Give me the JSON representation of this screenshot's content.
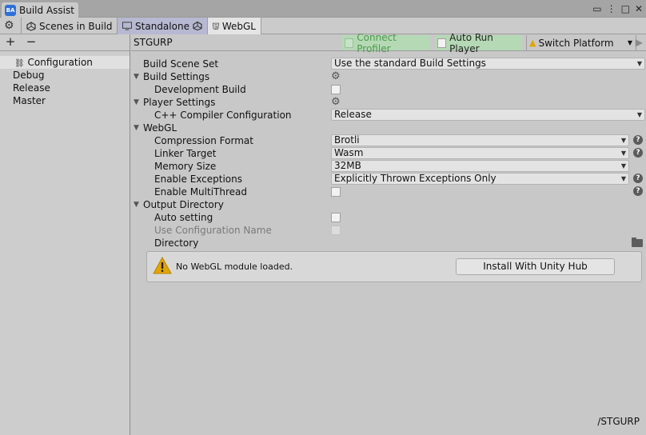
{
  "window": {
    "title": "Build Assist",
    "app_icon_text": "BA"
  },
  "toolbar": {
    "tabs": [
      {
        "label": "Scenes in Build",
        "icon": "unity-logo-icon"
      },
      {
        "label": "Standalone",
        "icon": "monitor-icon"
      },
      {
        "label": "WebGL",
        "icon": "html5-icon"
      }
    ]
  },
  "left_panel": {
    "add_label": "+",
    "remove_label": "−",
    "items": [
      "Configuration",
      "Debug",
      "Release",
      "Master"
    ],
    "selected": "Configuration"
  },
  "right_panel": {
    "title": "STGURP",
    "connect_profiler": "Connect Profiler",
    "auto_run_player": "Auto Run Player",
    "switch_platform": "Switch Platform",
    "rows": {
      "build_scene_set": {
        "label": "Build Scene Set",
        "value": "Use the standard Build Settings"
      },
      "build_settings": "Build Settings",
      "development_build": "Development Build",
      "player_settings": "Player Settings",
      "cpp_compiler": {
        "label": "C++ Compiler Configuration",
        "value": "Release"
      },
      "webgl": "WebGL",
      "compression_format": {
        "label": "Compression Format",
        "value": "Brotli"
      },
      "linker_target": {
        "label": "Linker Target",
        "value": "Wasm"
      },
      "memory_size": {
        "label": "Memory Size",
        "value": "32MB"
      },
      "enable_exceptions": {
        "label": "Enable Exceptions",
        "value": "Explicitly Thrown Exceptions Only"
      },
      "enable_multithread": "Enable MultiThread",
      "output_directory": "Output Directory",
      "auto_setting": "Auto setting",
      "use_configuration_name": "Use Configuration Name",
      "directory": "Directory"
    },
    "helpbox": {
      "message": "No WebGL module loaded.",
      "button": "Install With Unity Hub"
    },
    "footer_path": "/STGURP"
  },
  "colors": {
    "active_tab": "#b7b9d2",
    "green_toggle": "#b5d9b5",
    "warning": "#e2a500"
  }
}
